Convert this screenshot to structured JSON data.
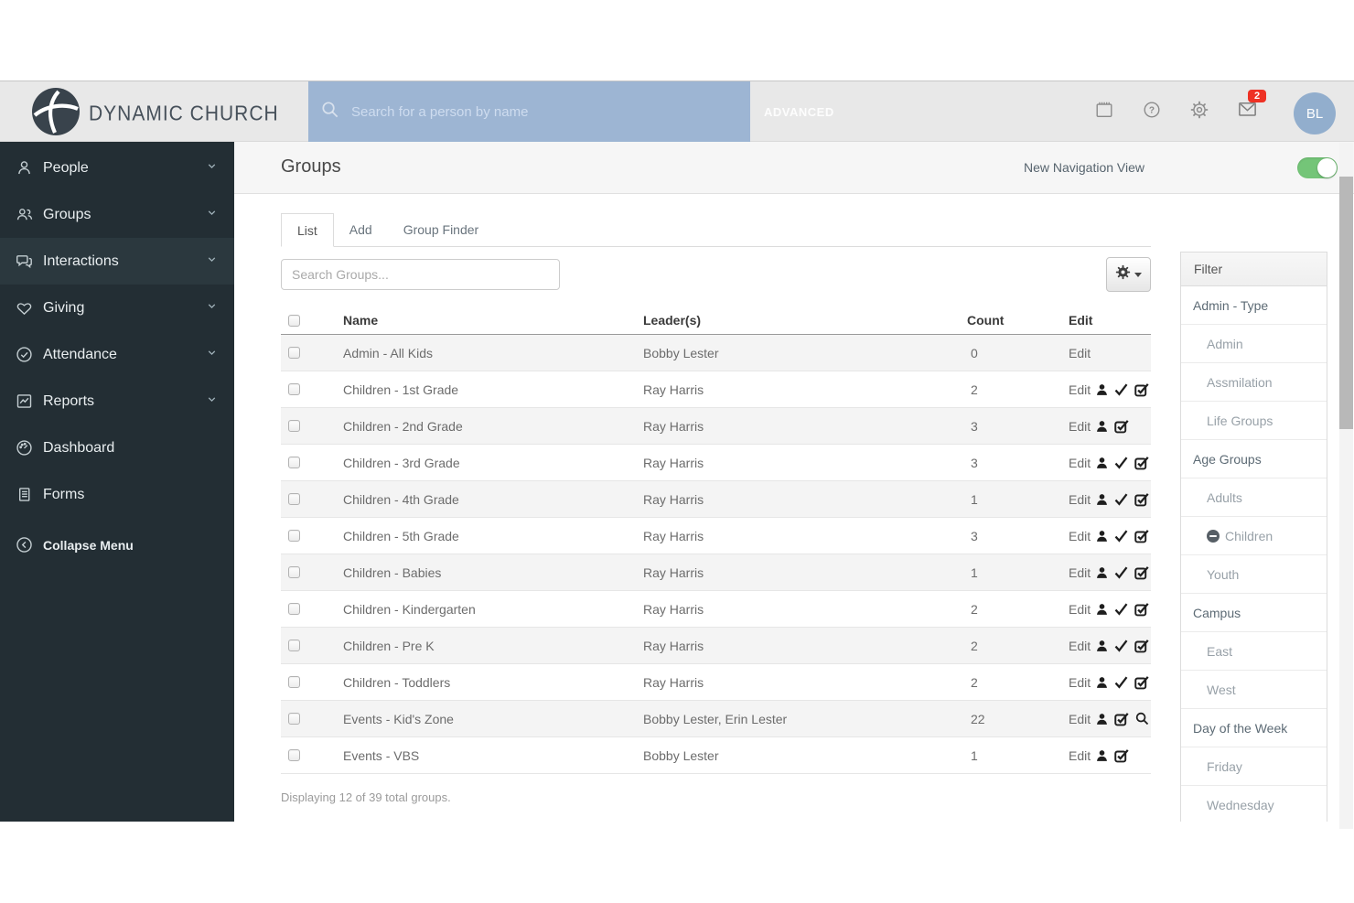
{
  "header": {
    "brand": "DYNAMIC CHURCH",
    "search_placeholder": "Search for a person by name",
    "advanced_label": "ADVANCED",
    "icons": [
      {
        "name": "calendar-icon"
      },
      {
        "name": "help-icon"
      },
      {
        "name": "settings-icon"
      },
      {
        "name": "mail-icon",
        "badge": "2"
      }
    ],
    "avatar_initials": "BL"
  },
  "sidebar": {
    "items": [
      {
        "label": "People",
        "icon": "person-icon",
        "expandable": true,
        "active": false
      },
      {
        "label": "Groups",
        "icon": "people-icon",
        "expandable": true,
        "active": false
      },
      {
        "label": "Interactions",
        "icon": "chat-icon",
        "expandable": true,
        "active": true
      },
      {
        "label": "Giving",
        "icon": "heart-icon",
        "expandable": true,
        "active": false
      },
      {
        "label": "Attendance",
        "icon": "check-circle-icon",
        "expandable": true,
        "active": false
      },
      {
        "label": "Reports",
        "icon": "chart-icon",
        "expandable": true,
        "active": false
      },
      {
        "label": "Dashboard",
        "icon": "dashboard-icon",
        "expandable": false,
        "active": false
      },
      {
        "label": "Forms",
        "icon": "forms-icon",
        "expandable": false,
        "active": false
      }
    ],
    "collapse_label": "Collapse Menu"
  },
  "page": {
    "title": "Groups",
    "nav_toggle_label": "New Navigation View",
    "nav_toggle_on": true
  },
  "tabs": [
    {
      "label": "List",
      "active": true
    },
    {
      "label": "Add",
      "active": false
    },
    {
      "label": "Group Finder",
      "active": false
    }
  ],
  "toolbar": {
    "search_placeholder": "Search Groups...",
    "settings_icon": "gear-icon"
  },
  "table": {
    "headers": [
      "Name",
      "Leader(s)",
      "Count",
      "Edit"
    ],
    "edit_label": "Edit",
    "rows": [
      {
        "name": "Admin - All Kids",
        "leaders": "Bobby Lester",
        "count": "0",
        "icons": []
      },
      {
        "name": "Children - 1st Grade",
        "leaders": "Ray Harris",
        "count": "2",
        "icons": [
          "person",
          "check",
          "check-square"
        ]
      },
      {
        "name": "Children - 2nd Grade",
        "leaders": "Ray Harris",
        "count": "3",
        "icons": [
          "person",
          "check-square"
        ]
      },
      {
        "name": "Children - 3rd Grade",
        "leaders": "Ray Harris",
        "count": "3",
        "icons": [
          "person",
          "check",
          "check-square"
        ]
      },
      {
        "name": "Children - 4th Grade",
        "leaders": "Ray Harris",
        "count": "1",
        "icons": [
          "person",
          "check",
          "check-square"
        ]
      },
      {
        "name": "Children - 5th Grade",
        "leaders": "Ray Harris",
        "count": "3",
        "icons": [
          "person",
          "check",
          "check-square"
        ]
      },
      {
        "name": "Children - Babies",
        "leaders": "Ray Harris",
        "count": "1",
        "icons": [
          "person",
          "check",
          "check-square"
        ]
      },
      {
        "name": "Children - Kindergarten",
        "leaders": "Ray Harris",
        "count": "2",
        "icons": [
          "person",
          "check",
          "check-square"
        ]
      },
      {
        "name": "Children - Pre K",
        "leaders": "Ray Harris",
        "count": "2",
        "icons": [
          "person",
          "check",
          "check-square"
        ]
      },
      {
        "name": "Children - Toddlers",
        "leaders": "Ray Harris",
        "count": "2",
        "icons": [
          "person",
          "check",
          "check-square"
        ]
      },
      {
        "name": "Events - Kid's Zone",
        "leaders": "Bobby Lester, Erin Lester",
        "count": "22",
        "icons": [
          "person",
          "check-square",
          "search"
        ]
      },
      {
        "name": "Events - VBS",
        "leaders": "Bobby Lester",
        "count": "1",
        "icons": [
          "person",
          "check-square"
        ]
      }
    ],
    "footer": "Displaying 12 of 39 total groups."
  },
  "filter": {
    "title": "Filter",
    "items": [
      {
        "label": "Admin - Type",
        "type": "category"
      },
      {
        "label": "Admin",
        "type": "option"
      },
      {
        "label": "Assmilation",
        "type": "option"
      },
      {
        "label": "Life Groups",
        "type": "option"
      },
      {
        "label": "Age Groups",
        "type": "category"
      },
      {
        "label": "Adults",
        "type": "option"
      },
      {
        "label": "Children",
        "type": "option",
        "icon": "minus-circle-icon"
      },
      {
        "label": "Youth",
        "type": "option"
      },
      {
        "label": "Campus",
        "type": "category"
      },
      {
        "label": "East",
        "type": "option"
      },
      {
        "label": "West",
        "type": "option"
      },
      {
        "label": "Day of the Week",
        "type": "category"
      },
      {
        "label": "Friday",
        "type": "option"
      },
      {
        "label": "Wednesday",
        "type": "option"
      }
    ]
  },
  "colors": {
    "sidebar_bg": "#232e34",
    "header_bg": "#e8e8e8",
    "search_blue": "#9db5d3",
    "avatar_blue": "#92aecd",
    "badge_red": "#ee3124",
    "toggle_green": "#74c578",
    "row_stripe": "#f4f4f4"
  }
}
